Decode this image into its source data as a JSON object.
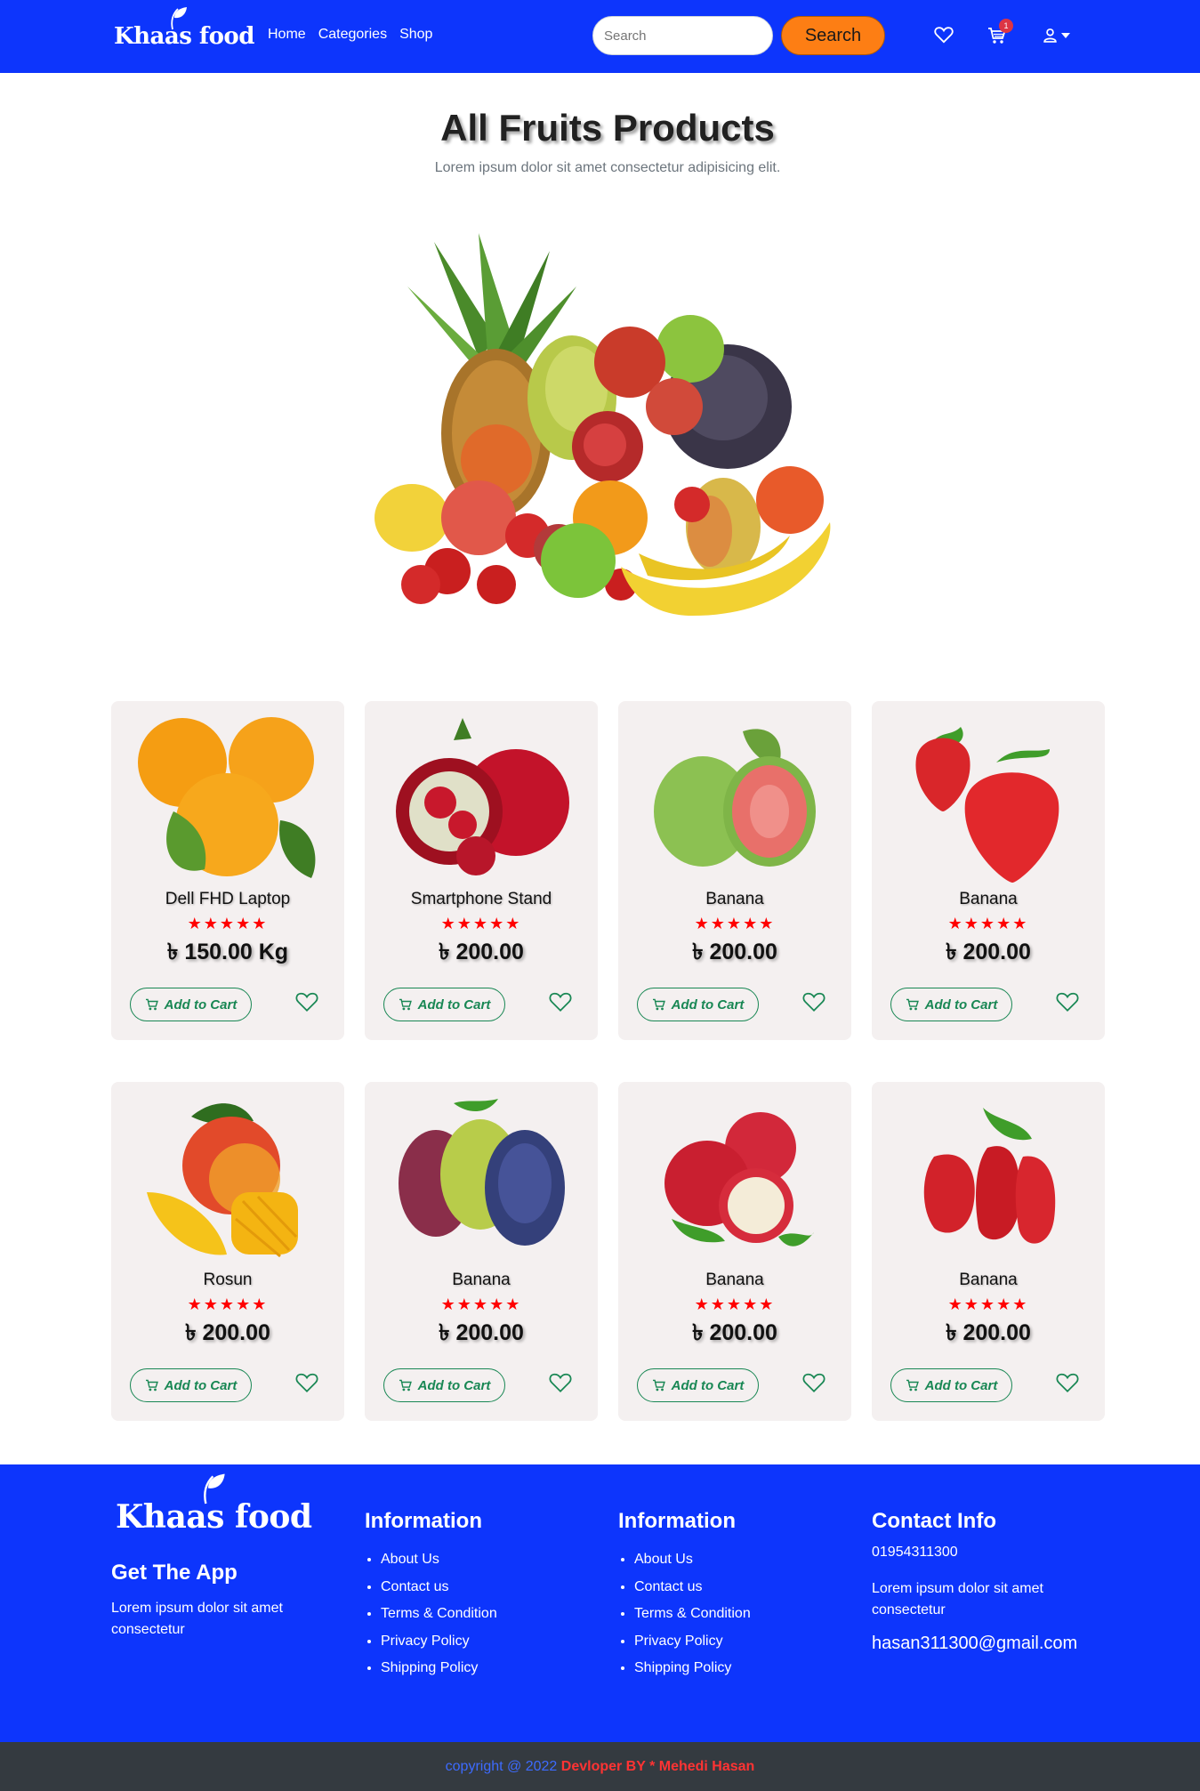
{
  "brand": {
    "name": "Khaas food"
  },
  "colors": {
    "navbar": "#0d35fc",
    "search_button": "#fd7e14",
    "rating": "#ff0000",
    "cart_outline": "#198754",
    "footer": "#0d35fc",
    "copyright_bg": "#343a40"
  },
  "nav": {
    "links": [
      "Home",
      "Categories",
      "Shop"
    ]
  },
  "search": {
    "placeholder": "Search",
    "button_label": "Search"
  },
  "header_icons": {
    "wishlist": "heart-icon",
    "cart": "cart-icon",
    "cart_count": "1",
    "account": "user-icon"
  },
  "hero": {
    "title": "All Fruits Products",
    "subtitle": "Lorem ipsum dolor sit amet consectetur adipisicing elit.",
    "image": "fruit-assortment-image"
  },
  "products": [
    {
      "name": "Dell FHD Laptop",
      "price": "৳ 150.00 Kg",
      "rating": "★★★★★",
      "image": "oranges",
      "add_label": "Add to Cart"
    },
    {
      "name": "Smartphone Stand",
      "price": "৳ 200.00",
      "rating": "★★★★★",
      "image": "pomegranate",
      "add_label": "Add to Cart"
    },
    {
      "name": "Banana",
      "price": "৳ 200.00",
      "rating": "★★★★★",
      "image": "guava",
      "add_label": "Add to Cart"
    },
    {
      "name": "Banana",
      "price": "৳ 200.00",
      "rating": "★★★★★",
      "image": "strawberries",
      "add_label": "Add to Cart"
    },
    {
      "name": "Rosun",
      "price": "৳ 200.00",
      "rating": "★★★★★",
      "image": "mango",
      "add_label": "Add to Cart"
    },
    {
      "name": "Banana",
      "price": "৳ 200.00",
      "rating": "★★★★★",
      "image": "grapes",
      "add_label": "Add to Cart"
    },
    {
      "name": "Banana",
      "price": "৳ 200.00",
      "rating": "★★★★★",
      "image": "apples",
      "add_label": "Add to Cart"
    },
    {
      "name": "Banana",
      "price": "৳ 200.00",
      "rating": "★★★★★",
      "image": "rose-apples",
      "add_label": "Add to Cart"
    }
  ],
  "footer": {
    "app_title": "Get The App",
    "app_text": "Lorem ipsum dolor sit amet consectetur",
    "columns": [
      {
        "heading": "Information",
        "links": [
          "About Us",
          "Contact us",
          "Terms & Condition",
          "Privacy Policy",
          "Shipping Policy"
        ]
      },
      {
        "heading": "Information",
        "links": [
          "About Us",
          "Contact us",
          "Terms & Condition",
          "Privacy Policy",
          "Shipping Policy"
        ]
      }
    ],
    "contact": {
      "heading": "Contact Info",
      "phone": "01954311300",
      "text": "Lorem ipsum dolor sit amet consectetur",
      "email": "hasan311300@gmail.com"
    },
    "copyright": "copyright @ 2022",
    "developer": "Devloper BY * Mehedi Hasan"
  }
}
